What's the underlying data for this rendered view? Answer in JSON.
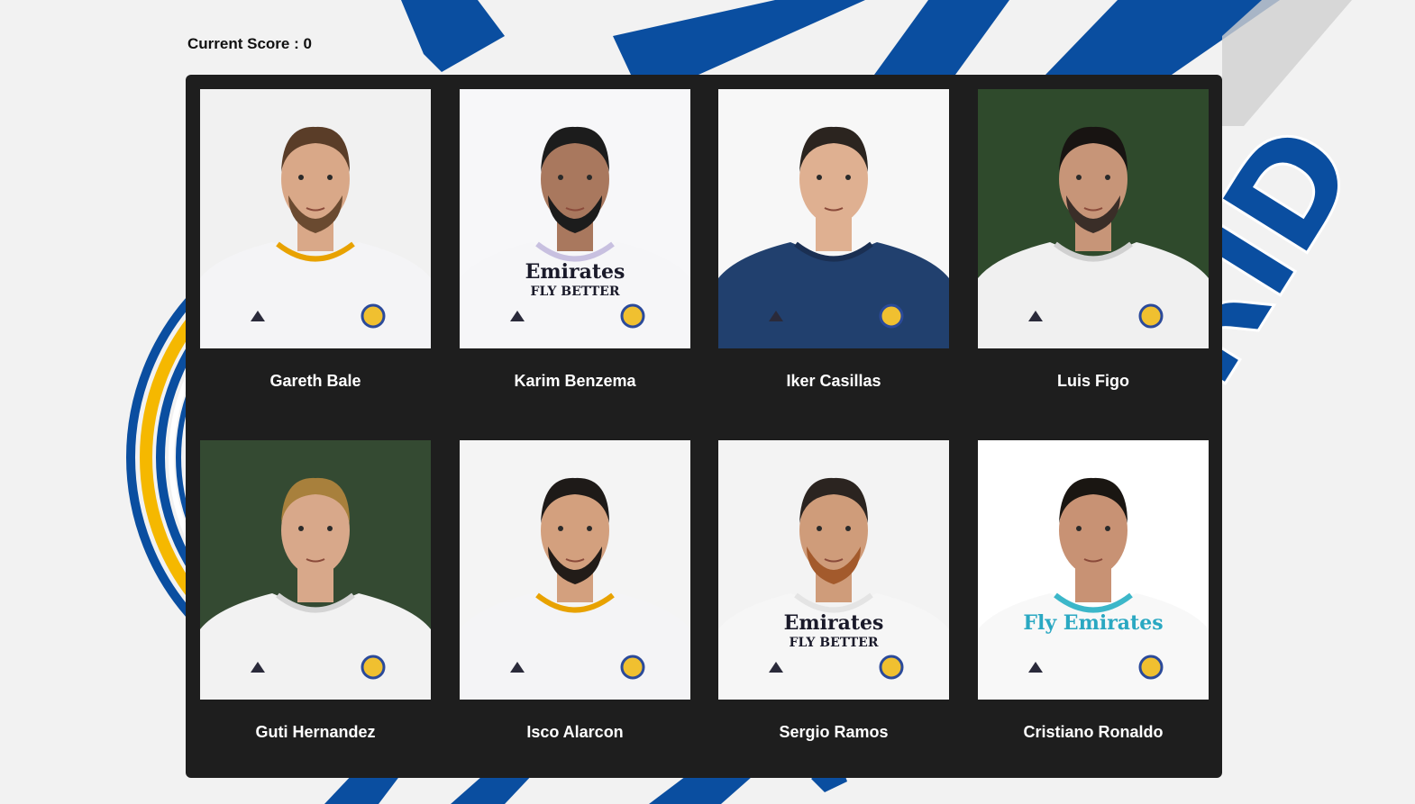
{
  "score": {
    "text": "Current Score : 0"
  },
  "colors": {
    "background": "#f2f2f2",
    "stripe_blue": "#0a4ea0",
    "crest_gold": "#f5b800",
    "board": "#1e1e1e",
    "name_text": "#ffffff"
  },
  "background_logo": {
    "text": "MADRID",
    "visible_text": "RID"
  },
  "cards": [
    {
      "name": "Gareth Bale",
      "photo_bg": "#f1f1f1",
      "shirt": "#f4f4f6",
      "trim": "#e8a200",
      "hair": "#5a3d28",
      "beard": "#6a4a30",
      "skin": "#d9a888",
      "sponsor": ""
    },
    {
      "name": "Karim Benzema",
      "photo_bg": "#f7f7f9",
      "shirt": "#f6f6f8",
      "trim": "#c8c0e0",
      "hair": "#1c1c1c",
      "beard": "#1c1c1c",
      "skin": "#a9785e",
      "sponsor": "Emirates",
      "sponsor_sub": "FLY BETTER"
    },
    {
      "name": "Iker Casillas",
      "photo_bg": "#f7f7f7",
      "shirt": "#21406e",
      "trim": "#1a2f52",
      "hair": "#2b241f",
      "beard": "",
      "skin": "#dfb091",
      "sponsor": ""
    },
    {
      "name": "Luis Figo",
      "photo_bg": "#2f4a2c",
      "shirt": "#f0f0f0",
      "trim": "#d0d0d0",
      "hair": "#181412",
      "beard": "#3a2e28",
      "skin": "#c79578",
      "sponsor": ""
    },
    {
      "name": "Guti Hernandez",
      "photo_bg": "#344a32",
      "shirt": "#f2f2f2",
      "trim": "#d4d4d4",
      "hair": "#a8803c",
      "beard": "",
      "skin": "#d8a88a",
      "sponsor": ""
    },
    {
      "name": "Isco Alarcon",
      "photo_bg": "#f4f4f4",
      "shirt": "#f4f4f6",
      "trim": "#e8a200",
      "hair": "#1e1a18",
      "beard": "#221c18",
      "skin": "#d3a07e",
      "sponsor": ""
    },
    {
      "name": "Sergio Ramos",
      "photo_bg": "#f3f3f3",
      "shirt": "#f6f6f6",
      "trim": "#e4e4e4",
      "hair": "#2b2420",
      "beard": "#a35a2c",
      "skin": "#cf9c7a",
      "sponsor": "Emirates",
      "sponsor_sub": "FLY BETTER"
    },
    {
      "name": "Cristiano Ronaldo",
      "photo_bg": "#ffffff",
      "shirt": "#f8f8f8",
      "trim": "#3cb7c9",
      "hair": "#1a1612",
      "beard": "",
      "skin": "#c89274",
      "sponsor": "Fly Emirates",
      "sponsor_color": "#2aa8c2"
    }
  ]
}
